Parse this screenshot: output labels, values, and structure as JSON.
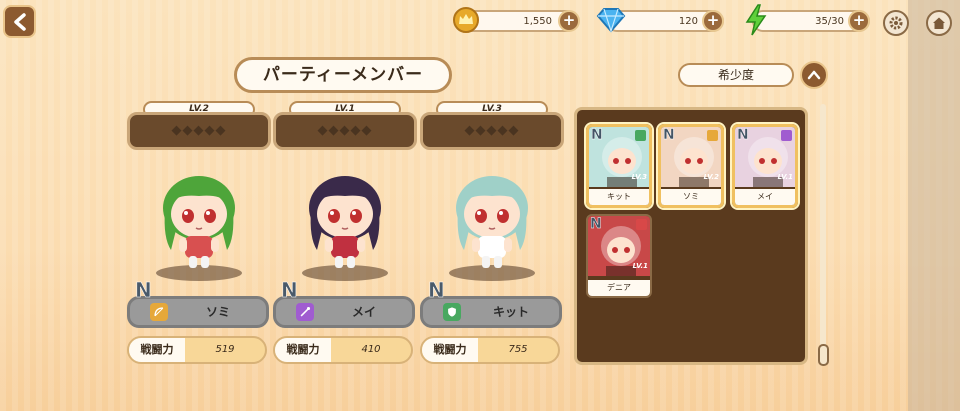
{
  "header": {
    "gold": "1,550",
    "gems": "120",
    "stamina": "35/30",
    "plus_symbol": "+"
  },
  "title": "パーティーメンバー",
  "sort_label": "希少度",
  "party": [
    {
      "level": "LV.2",
      "name": "ソミ",
      "rarity": "N",
      "power_label": "戦闘力",
      "power": "519",
      "role": "bow-icon",
      "role_color": "#e6a83a",
      "hair": "#4ea53a",
      "outfit": "#d85050"
    },
    {
      "level": "LV.1",
      "name": "メイ",
      "rarity": "N",
      "power_label": "戦闘力",
      "power": "410",
      "role": "wand-icon",
      "role_color": "#a05cd0",
      "hair": "#3a2a4a",
      "outfit": "#c03040"
    },
    {
      "level": "LV.3",
      "name": "キット",
      "rarity": "N",
      "power_label": "戦闘力",
      "power": "755",
      "role": "shield-icon",
      "role_color": "#48a860",
      "hair": "#9fd0c8",
      "outfit": "#ffffff"
    }
  ],
  "inventory": [
    {
      "name": "キット",
      "level": "LV.3",
      "rarity": "N",
      "selected": true,
      "role_color": "#48a860",
      "bg": "#bfe3de"
    },
    {
      "name": "ソミ",
      "level": "LV.2",
      "rarity": "N",
      "selected": true,
      "role_color": "#e6a83a",
      "bg": "#f2d6c2"
    },
    {
      "name": "メイ",
      "level": "LV.1",
      "rarity": "N",
      "selected": true,
      "role_color": "#a05cd0",
      "bg": "#e8d2e0"
    },
    {
      "name": "デニア",
      "level": "LV.1",
      "rarity": "N",
      "selected": false,
      "role_color": "#d84848",
      "bg": "#c84848"
    }
  ],
  "colors": {
    "accent": "#8c5a30",
    "panel": "#5a3a1e",
    "highlight": "#f0c060"
  }
}
